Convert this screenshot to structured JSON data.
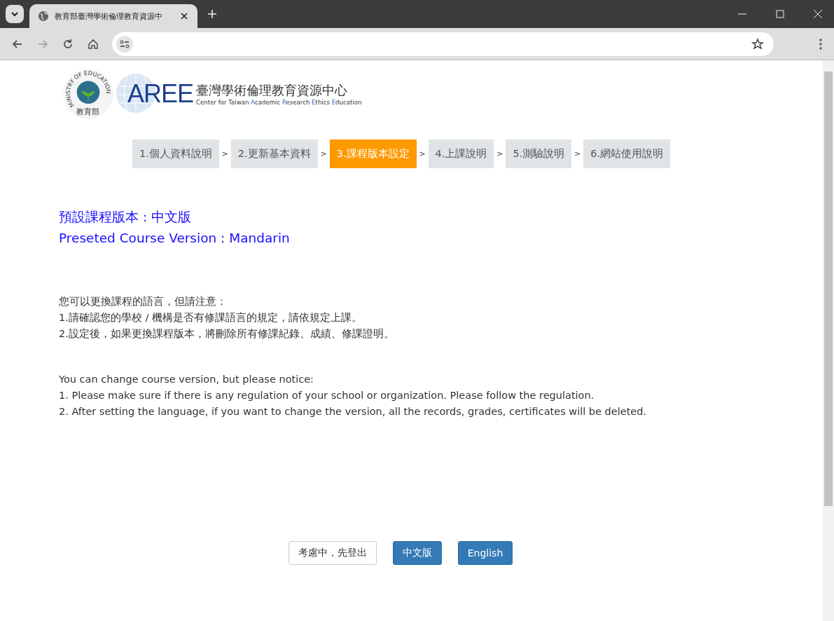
{
  "browser": {
    "tab_title": "教育部臺灣學術倫理教育資源中"
  },
  "logo": {
    "seal_text": "MINISTRY OF EDUCATION",
    "seal_name": "教育部",
    "mark": "AREE",
    "title": "臺灣學術倫理教育資源中心",
    "subtitle_parts": [
      {
        "rest": "Center for Taiwan "
      },
      {
        "initial": "A",
        "rest": "cademic "
      },
      {
        "initial": "R",
        "rest": "esearch "
      },
      {
        "initial": "E",
        "rest": "thics "
      },
      {
        "initial": "E",
        "rest": "ducation"
      }
    ]
  },
  "steps": [
    {
      "label": "1.個人資料說明",
      "selected": false
    },
    {
      "label": "2.更新基本資料",
      "selected": false
    },
    {
      "label": "3.課程版本設定",
      "selected": true
    },
    {
      "label": "4.上課說明",
      "selected": false
    },
    {
      "label": "5.測驗說明",
      "selected": false
    },
    {
      "label": "6.網站使用說明",
      "selected": false
    }
  ],
  "step_separator": ">",
  "default_version": [
    "預設課程版本 : 中文版",
    "Preseted Course Version : Mandarin"
  ],
  "notices": [
    [
      "您可以更換課程的語言，但請注意：",
      "1.請確認您的學校 / 機構是否有修課語言的規定，請依規定上課。",
      "2.設定後，如果更換課程版本，將刪除所有修課紀錄、成績、修課證明。"
    ],
    [
      "You can change course version, but please notice:",
      "1. Please make sure if there is any regulation of your school or organization. Please follow the regulation.",
      "2. After setting the language, if you want to change the version, all the records, grades, certificates will be deleted."
    ]
  ],
  "buttons": [
    {
      "label": "考慮中，先登出",
      "kind": "outline"
    },
    {
      "label": "中文版",
      "kind": "primary"
    },
    {
      "label": "English",
      "kind": "primary"
    }
  ]
}
